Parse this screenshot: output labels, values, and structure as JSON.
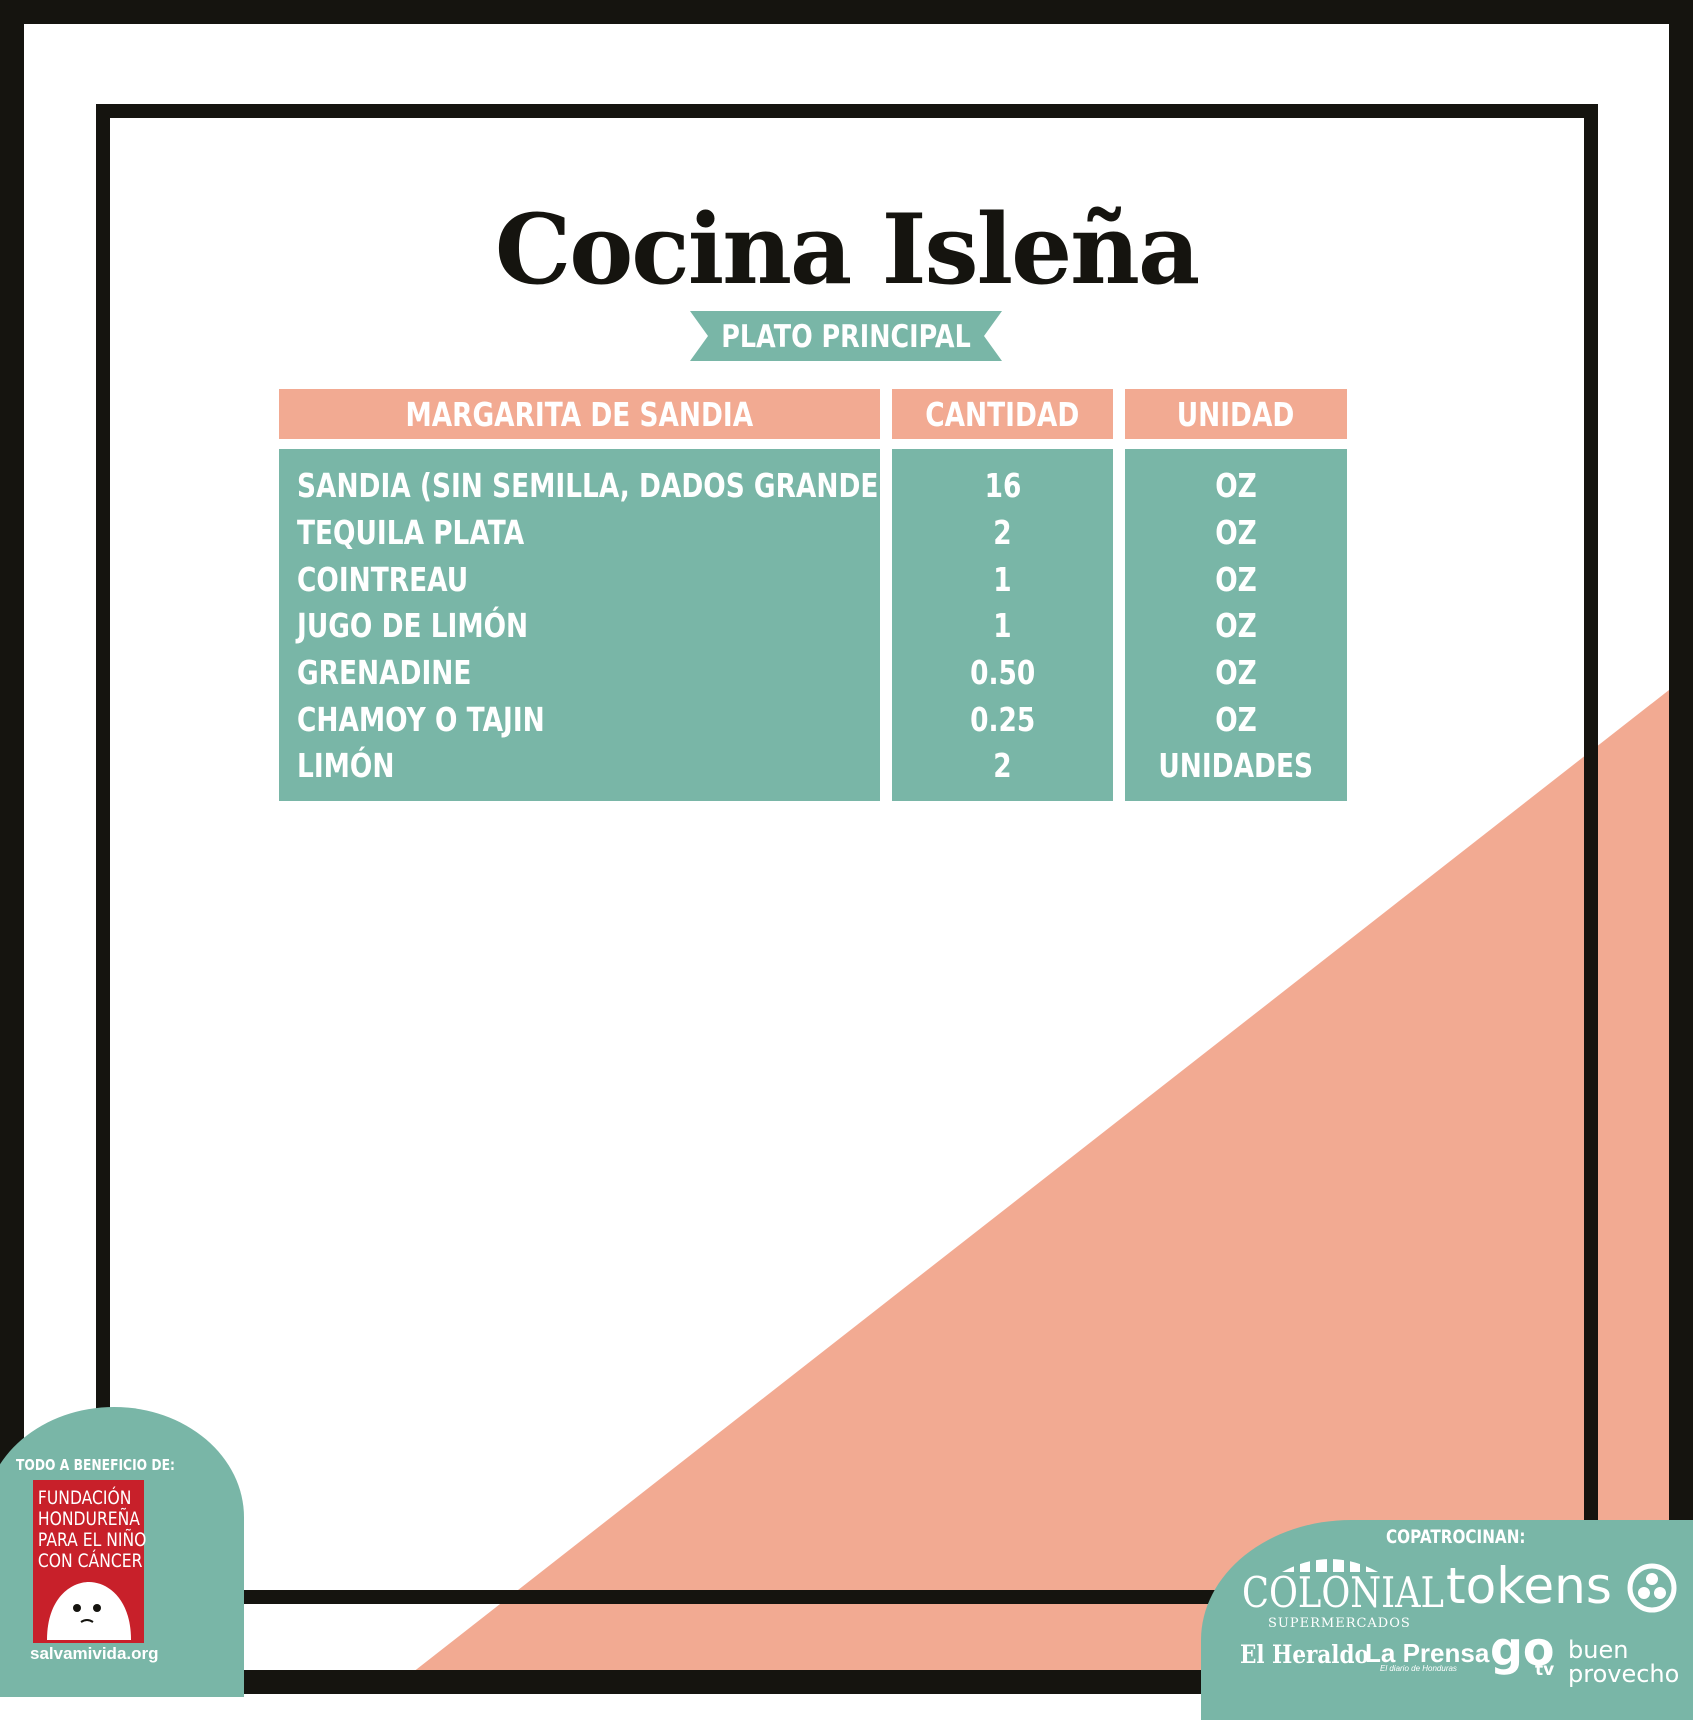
{
  "title": "Cocina Isleña",
  "subtitle": "PLATO PRINCIPAL",
  "table": {
    "columns": [
      "MARGARITA DE SANDIA",
      "CANTIDAD",
      "UNIDAD"
    ],
    "rows": [
      {
        "ingredient": "SANDIA (SIN SEMILLA, DADOS GRANDES)",
        "quantity": "16",
        "unit": "OZ"
      },
      {
        "ingredient": "TEQUILA PLATA",
        "quantity": "2",
        "unit": "OZ"
      },
      {
        "ingredient": "COINTREAU",
        "quantity": "1",
        "unit": "OZ"
      },
      {
        "ingredient": "JUGO DE LIMÓN",
        "quantity": "1",
        "unit": "OZ"
      },
      {
        "ingredient": "GRENADINE",
        "quantity": "0.50",
        "unit": "OZ"
      },
      {
        "ingredient": "CHAMOY O TAJIN",
        "quantity": "0.25",
        "unit": "OZ"
      },
      {
        "ingredient": "LIMÓN",
        "quantity": "2",
        "unit": "UNIDADES"
      }
    ]
  },
  "beneficiary": {
    "label": "TODO A BENEFICIO DE:",
    "logo_lines": [
      "FUNDACIÓN",
      "HONDUREÑA",
      "PARA EL NIÑO",
      "CON CÁNCER"
    ],
    "website": "salvamivida.org"
  },
  "sponsors": {
    "label": "COPATROCINAN:",
    "colonial": "COLONIAL",
    "colonial_sub": "SUPERMERCADOS",
    "tokens": "tokens",
    "el_heraldo": "El Heraldo",
    "la_prensa": "La Prensa",
    "la_prensa_sub": "El diario de Honduras",
    "go": "go",
    "go_tv": "tv",
    "buen": "buen",
    "provecho": "provecho"
  },
  "colors": {
    "salmon": "#f2aa92",
    "teal": "#79b6a7",
    "frame": "#15140f",
    "red": "#c8202a"
  }
}
